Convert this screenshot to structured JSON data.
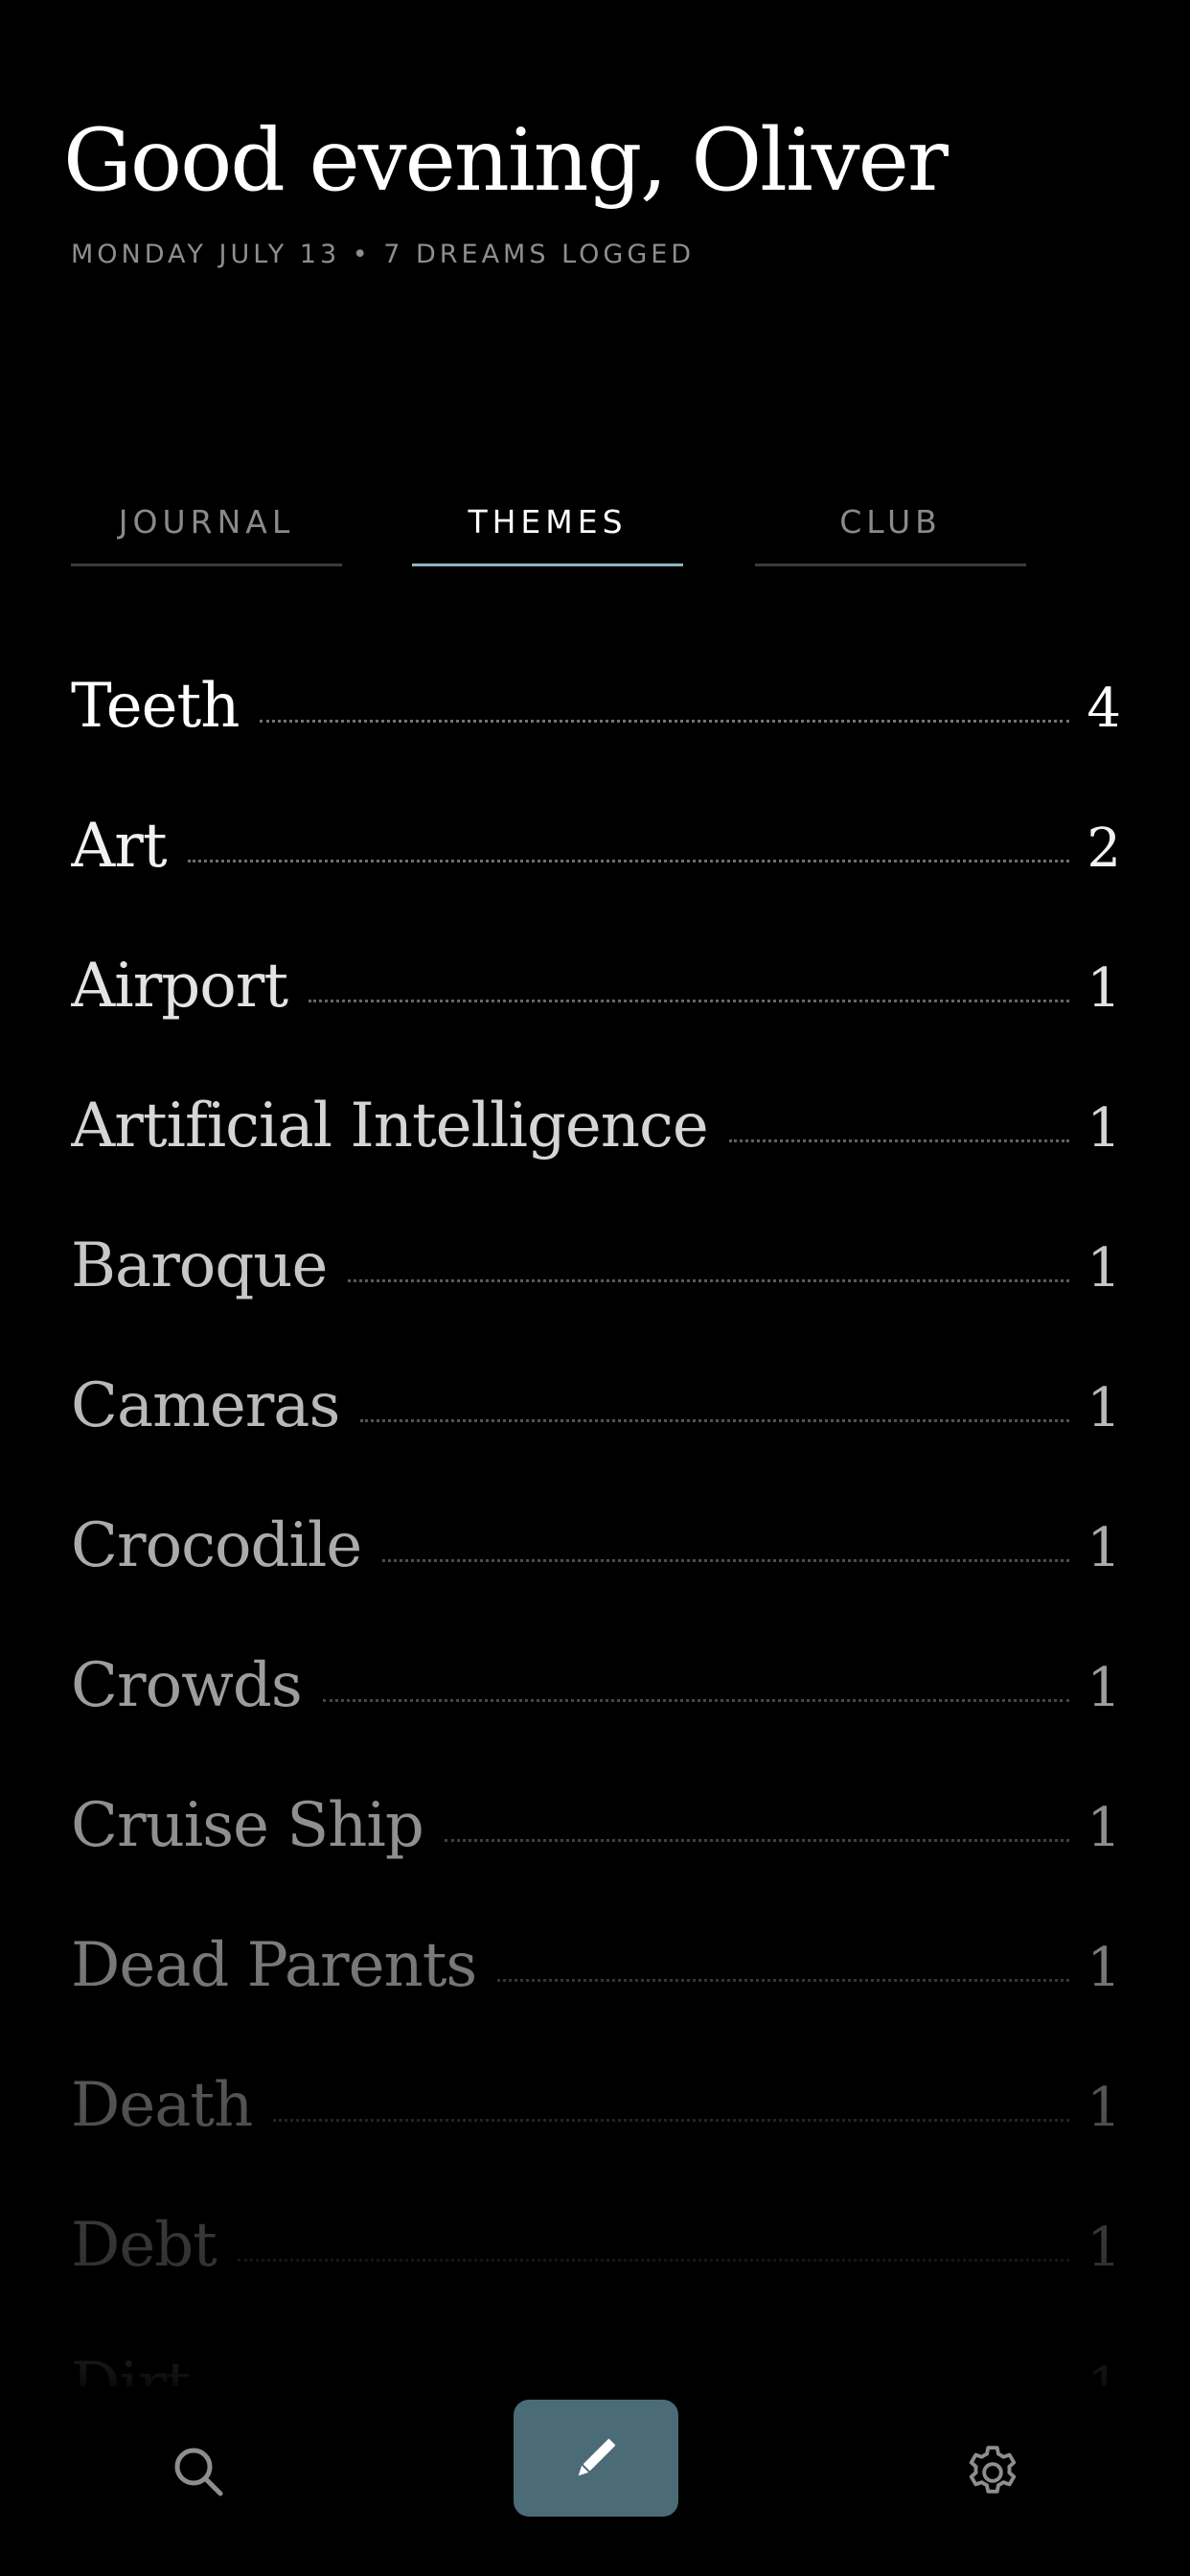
{
  "header": {
    "greeting": "Good evening, Oliver",
    "subtitle": "MONDAY JULY 13 • 7 DREAMS LOGGED"
  },
  "tabs": [
    {
      "label": "JOURNAL",
      "active": false
    },
    {
      "label": "THEMES",
      "active": true
    },
    {
      "label": "CLUB",
      "active": false
    }
  ],
  "themes": [
    {
      "name": "Teeth",
      "count": "4"
    },
    {
      "name": "Art",
      "count": "2"
    },
    {
      "name": "Airport",
      "count": "1"
    },
    {
      "name": "Artificial Intelligence",
      "count": "1"
    },
    {
      "name": "Baroque",
      "count": "1"
    },
    {
      "name": "Cameras",
      "count": "1"
    },
    {
      "name": "Crocodile",
      "count": "1"
    },
    {
      "name": "Crowds",
      "count": "1"
    },
    {
      "name": "Cruise Ship",
      "count": "1"
    },
    {
      "name": "Dead Parents",
      "count": "1"
    },
    {
      "name": "Death",
      "count": "1"
    },
    {
      "name": "Debt",
      "count": "1"
    },
    {
      "name": "Dirt",
      "count": "1"
    }
  ],
  "bottom_nav": {
    "search_icon": "search-icon",
    "compose_icon": "pencil-icon",
    "settings_icon": "gear-icon"
  },
  "colors": {
    "background": "#000000",
    "accent": "#8fb3c3",
    "compose_button": "#4b6b76",
    "text_primary": "#ffffff",
    "text_muted": "#8e8e8e"
  }
}
